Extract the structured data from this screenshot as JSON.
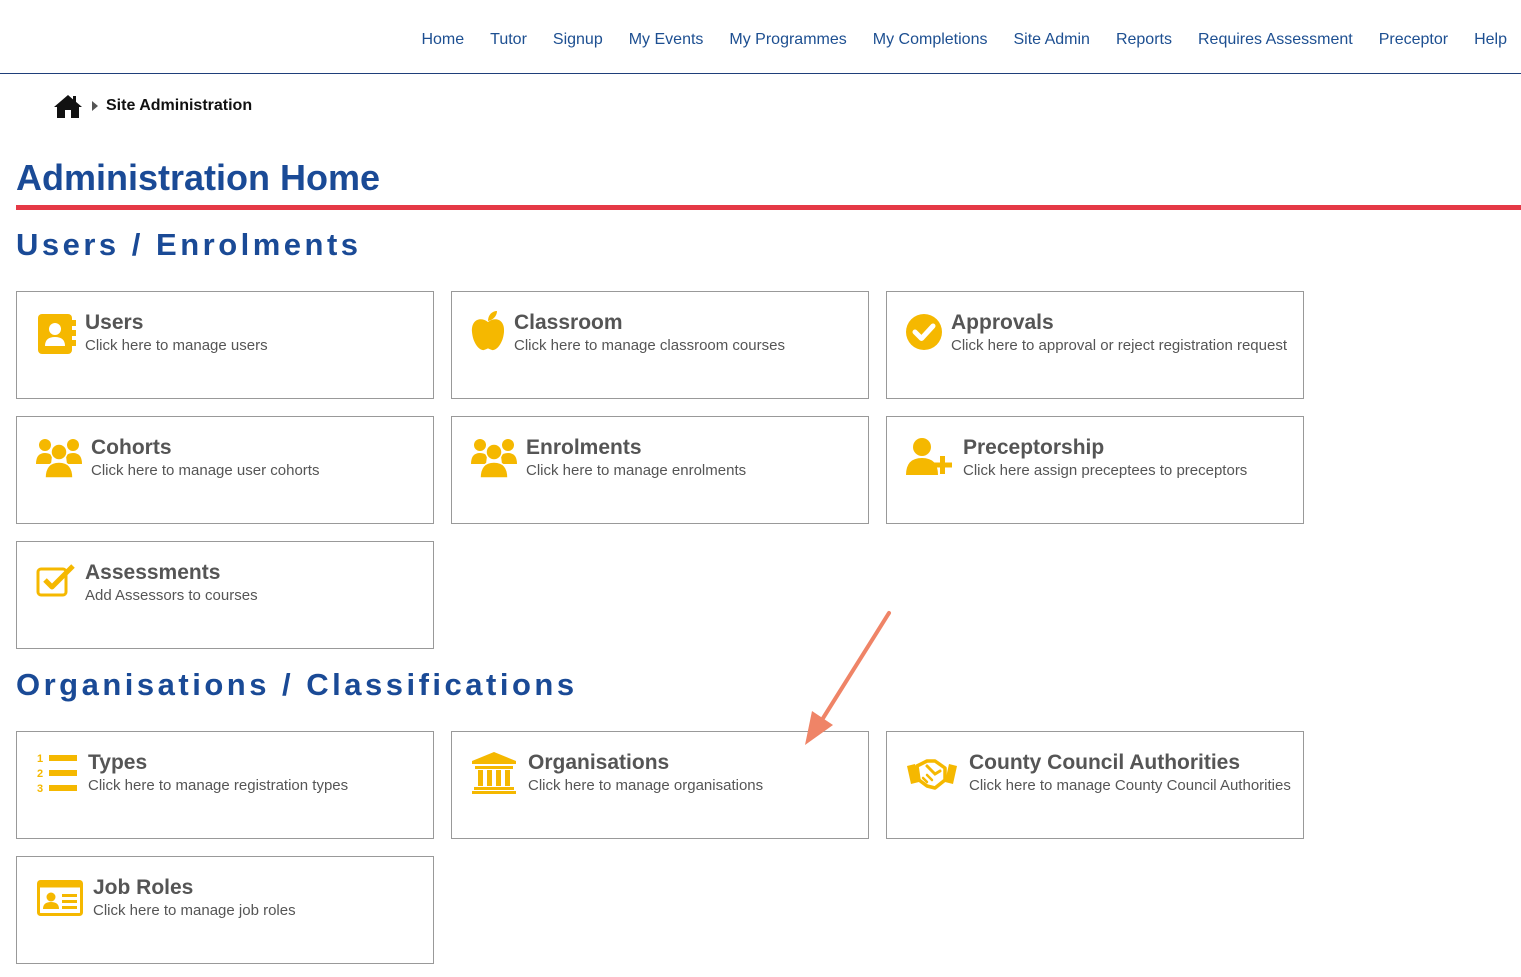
{
  "nav": {
    "items": [
      "Home",
      "Tutor",
      "Signup",
      "My Events",
      "My Programmes",
      "My Completions",
      "Site Admin",
      "Reports",
      "Requires Assessment",
      "Preceptor",
      "Help"
    ]
  },
  "breadcrumb": {
    "home_icon": "home-icon",
    "current": "Site Administration"
  },
  "page_title": "Administration Home",
  "sections": {
    "users": {
      "title": "Users / Enrolments",
      "cards": [
        {
          "title": "Users",
          "desc": "Click here to manage users",
          "icon": "address-book-icon"
        },
        {
          "title": "Classroom",
          "desc": "Click here to manage classroom courses",
          "icon": "apple-icon"
        },
        {
          "title": "Approvals",
          "desc": "Click here to approval or reject registration request",
          "icon": "check-circle-icon"
        },
        {
          "title": "Cohorts",
          "desc": "Click here to manage user cohorts",
          "icon": "users-group-icon"
        },
        {
          "title": "Enrolments",
          "desc": "Click here to manage enrolments",
          "icon": "users-group-icon"
        },
        {
          "title": "Preceptorship",
          "desc": "Click here assign preceptees to preceptors",
          "icon": "user-plus-icon"
        },
        {
          "title": "Assessments",
          "desc": "Add Assessors to courses",
          "icon": "checkbox-icon"
        }
      ]
    },
    "orgs": {
      "title": "Organisations / Classifications",
      "cards": [
        {
          "title": "Types",
          "desc": "Click here to manage registration types",
          "icon": "ordered-list-icon"
        },
        {
          "title": "Organisations",
          "desc": "Click here to manage organisations",
          "icon": "institution-icon"
        },
        {
          "title": "County Council Authorities",
          "desc": "Click here to manage County Council Authorities",
          "icon": "handshake-icon"
        },
        {
          "title": "Job Roles",
          "desc": "Click here to manage job roles",
          "icon": "id-card-icon"
        }
      ]
    }
  },
  "colors": {
    "accent": "#1a4a96",
    "link": "#1d4f91",
    "rule": "#e53946",
    "icon": "#f5b800",
    "annotation": "#ef8467"
  }
}
